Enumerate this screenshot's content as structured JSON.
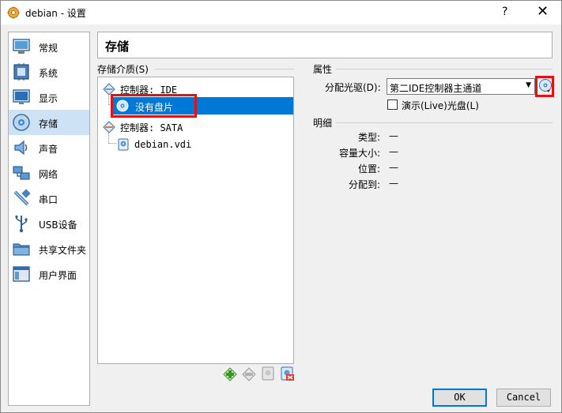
{
  "window": {
    "title": "debian - 设置",
    "help_label": "?",
    "close_label": "✕"
  },
  "sidebar": {
    "items": [
      {
        "label": "常规",
        "icon": "general-icon"
      },
      {
        "label": "系统",
        "icon": "system-icon"
      },
      {
        "label": "显示",
        "icon": "display-icon"
      },
      {
        "label": "存储",
        "icon": "storage-icon"
      },
      {
        "label": "声音",
        "icon": "audio-icon"
      },
      {
        "label": "网络",
        "icon": "network-icon"
      },
      {
        "label": "串口",
        "icon": "serial-port-icon"
      },
      {
        "label": "USB设备",
        "icon": "usb-icon"
      },
      {
        "label": "共享文件夹",
        "icon": "shared-folder-icon"
      },
      {
        "label": "用户界面",
        "icon": "user-interface-icon"
      }
    ],
    "selected_index": 3
  },
  "page": {
    "title": "存储"
  },
  "storage": {
    "media_label": "存储介质(S)",
    "tree": [
      {
        "label": "控制器: IDE",
        "kind": "controller"
      },
      {
        "label": "没有盘片",
        "kind": "optical-empty",
        "selected": true
      },
      {
        "label": "控制器: SATA",
        "kind": "controller"
      },
      {
        "label": "debian.vdi",
        "kind": "disk"
      }
    ]
  },
  "attributes": {
    "section_label": "属性",
    "drive_label": "分配光驱(D):",
    "drive_value": "第二IDE控制器主通道",
    "live_label": "演示(Live)光盘(L)",
    "live_checked": false
  },
  "details": {
    "section_label": "明细",
    "rows": [
      {
        "key": "类型:",
        "value": "—"
      },
      {
        "key": "容量大小:",
        "value": "—"
      },
      {
        "key": "位置:",
        "value": "—"
      },
      {
        "key": "分配到:",
        "value": "—"
      }
    ]
  },
  "buttons": {
    "ok_label": "OK",
    "cancel_label": "Cancel"
  },
  "colors": {
    "selection": "#0078d7",
    "highlight_box": "#e01414",
    "sidebar_selected": "#cde2f4"
  }
}
